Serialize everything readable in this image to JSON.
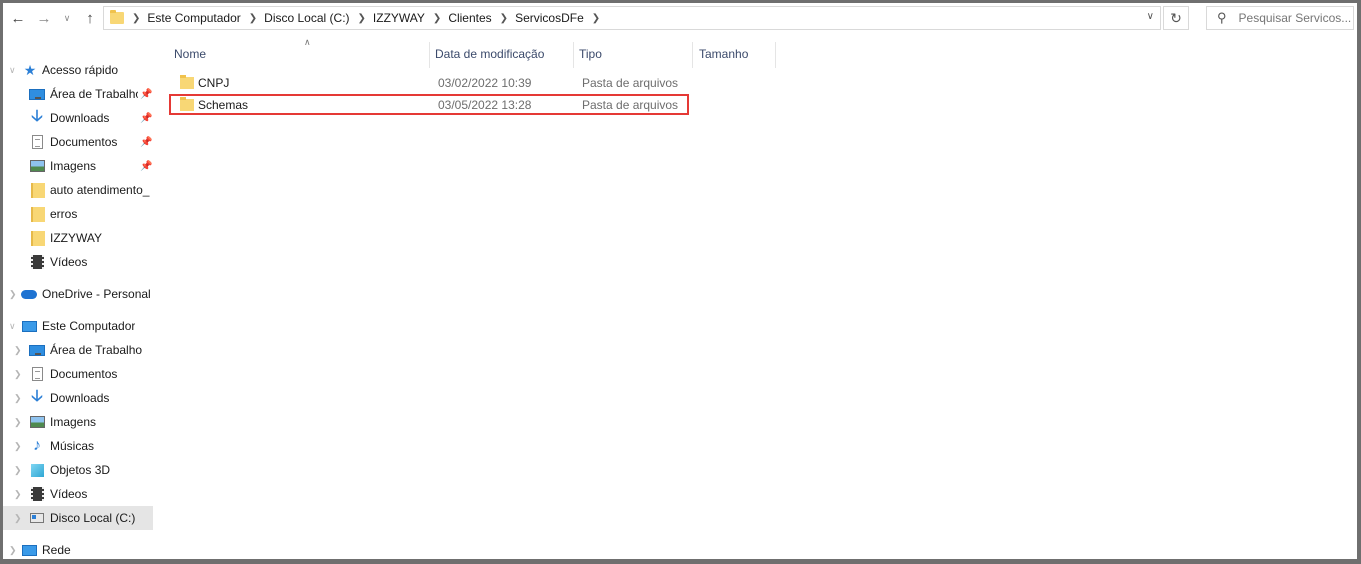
{
  "address_bar": {
    "breadcrumbs": [
      "Este Computador",
      "Disco Local (C:)",
      "IZZYWAY",
      "Clientes",
      "ServicosDFe"
    ]
  },
  "search": {
    "placeholder": "Pesquisar Servicos..."
  },
  "sidebar": {
    "quick_access": {
      "label": "Acesso rápido"
    },
    "quick_items": [
      {
        "label": "Área de Trabalho",
        "icon": "desktop-icon",
        "pinned": true
      },
      {
        "label": "Downloads",
        "icon": "download-icon",
        "pinned": true
      },
      {
        "label": "Documentos",
        "icon": "document-icon",
        "pinned": true
      },
      {
        "label": "Imagens",
        "icon": "image-icon",
        "pinned": true
      },
      {
        "label": "auto atendimento_",
        "icon": "folder-icon",
        "pinned": false
      },
      {
        "label": "erros",
        "icon": "folder-icon",
        "pinned": false
      },
      {
        "label": "IZZYWAY",
        "icon": "folder-icon",
        "pinned": false
      },
      {
        "label": "Vídeos",
        "icon": "video-icon",
        "pinned": false
      }
    ],
    "onedrive": {
      "label": "OneDrive - Personal"
    },
    "this_pc": {
      "label": "Este Computador"
    },
    "pc_items": [
      {
        "label": "Área de Trabalho",
        "icon": "desktop-icon"
      },
      {
        "label": "Documentos",
        "icon": "document-icon"
      },
      {
        "label": "Downloads",
        "icon": "download-icon"
      },
      {
        "label": "Imagens",
        "icon": "image-icon"
      },
      {
        "label": "Músicas",
        "icon": "music-icon"
      },
      {
        "label": "Objetos 3D",
        "icon": "3d-objects-icon"
      },
      {
        "label": "Vídeos",
        "icon": "video-icon"
      },
      {
        "label": "Disco Local (C:)",
        "icon": "disk-icon",
        "selected": true
      }
    ],
    "network": {
      "label": "Rede"
    }
  },
  "file_list": {
    "columns": {
      "name": "Nome",
      "modified": "Data de modificação",
      "type": "Tipo",
      "size": "Tamanho"
    },
    "rows": [
      {
        "name": "CNPJ",
        "modified": "03/02/2022 10:39",
        "type": "Pasta de arquivos",
        "size": ""
      },
      {
        "name": "Schemas",
        "modified": "03/05/2022 13:28",
        "type": "Pasta de arquivos",
        "size": "",
        "highlighted": true
      }
    ]
  },
  "colors": {
    "highlight_border": "#e53935",
    "selected_bg": "#e5e5e5",
    "header_text": "#3b4a6b",
    "folder": "#f8d775"
  }
}
